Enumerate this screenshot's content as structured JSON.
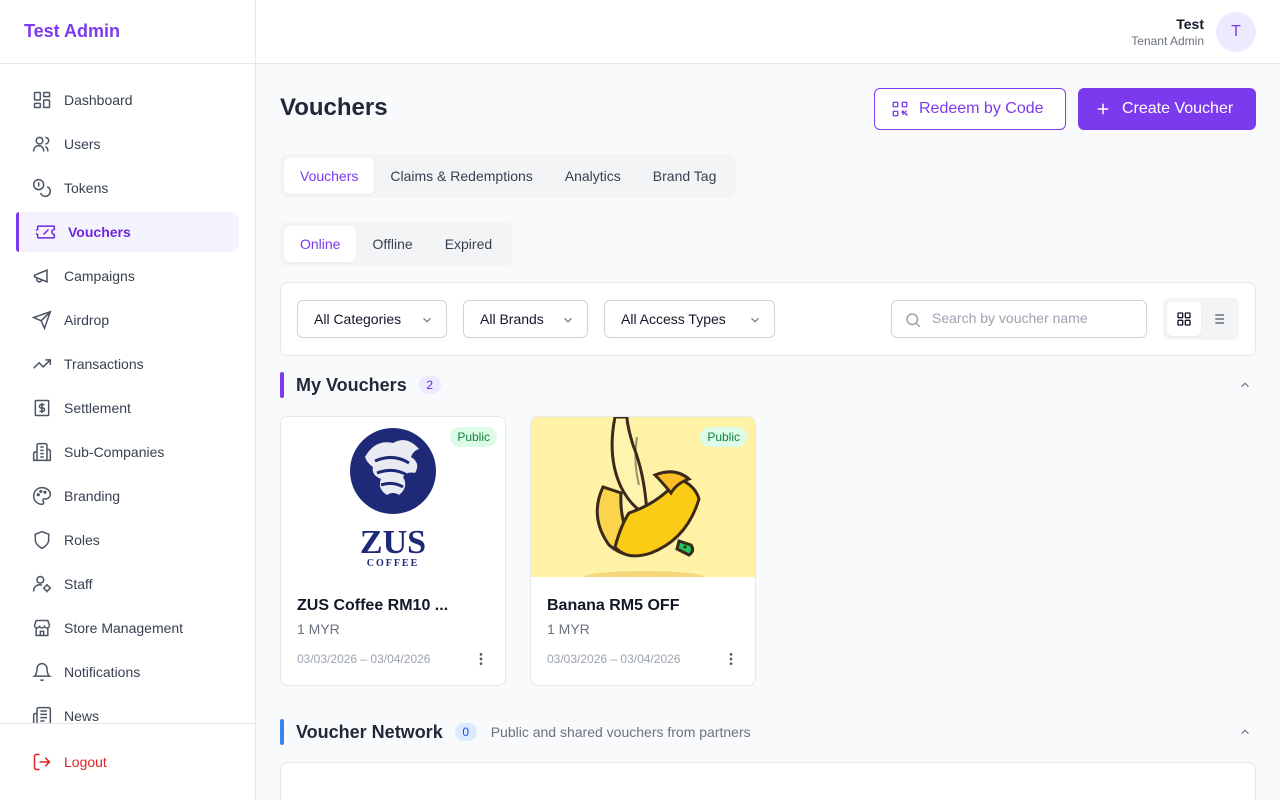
{
  "app": {
    "title": "Test Admin"
  },
  "sidebar": {
    "items": [
      {
        "label": "Dashboard",
        "icon": "dashboard-icon"
      },
      {
        "label": "Users",
        "icon": "users-icon"
      },
      {
        "label": "Tokens",
        "icon": "coins-icon"
      },
      {
        "label": "Vouchers",
        "icon": "ticket-icon",
        "active": true
      },
      {
        "label": "Campaigns",
        "icon": "megaphone-icon"
      },
      {
        "label": "Airdrop",
        "icon": "send-icon"
      },
      {
        "label": "Transactions",
        "icon": "trending-up-icon"
      },
      {
        "label": "Settlement",
        "icon": "dollar-receipt-icon"
      },
      {
        "label": "Sub-Companies",
        "icon": "buildings-icon"
      },
      {
        "label": "Branding",
        "icon": "palette-icon"
      },
      {
        "label": "Roles",
        "icon": "shield-icon"
      },
      {
        "label": "Staff",
        "icon": "user-cog-icon"
      },
      {
        "label": "Store Management",
        "icon": "store-icon"
      },
      {
        "label": "Notifications",
        "icon": "bell-icon"
      },
      {
        "label": "News",
        "icon": "newspaper-icon"
      }
    ],
    "logout_label": "Logout"
  },
  "user": {
    "name": "Test",
    "role": "Tenant Admin",
    "initial": "T"
  },
  "page": {
    "title": "Vouchers",
    "redeem_label": "Redeem by Code",
    "create_label": "Create Voucher"
  },
  "tabs": [
    "Vouchers",
    "Claims & Redemptions",
    "Analytics",
    "Brand Tag"
  ],
  "subtabs": [
    "Online",
    "Offline",
    "Expired"
  ],
  "filters": {
    "category": "All Categories",
    "brand": "All Brands",
    "access": "All Access Types",
    "search_placeholder": "Search by voucher name"
  },
  "my_vouchers": {
    "title": "My Vouchers",
    "count": "2",
    "cards": [
      {
        "title": "ZUS Coffee RM10 ...",
        "price": "1 MYR",
        "dates": "03/03/2026 – 03/04/2026",
        "badge": "Public",
        "image_text": "ZUS",
        "image_subtext": "COFFEE"
      },
      {
        "title": "Banana RM5 OFF",
        "price": "1 MYR",
        "dates": "03/03/2026 – 03/04/2026",
        "badge": "Public"
      }
    ]
  },
  "network": {
    "title": "Voucher Network",
    "count": "0",
    "subtitle": "Public and shared vouchers from partners"
  },
  "colors": {
    "accent": "#7c3aed",
    "network_accent": "#3b82f6",
    "danger": "#dc2626"
  }
}
